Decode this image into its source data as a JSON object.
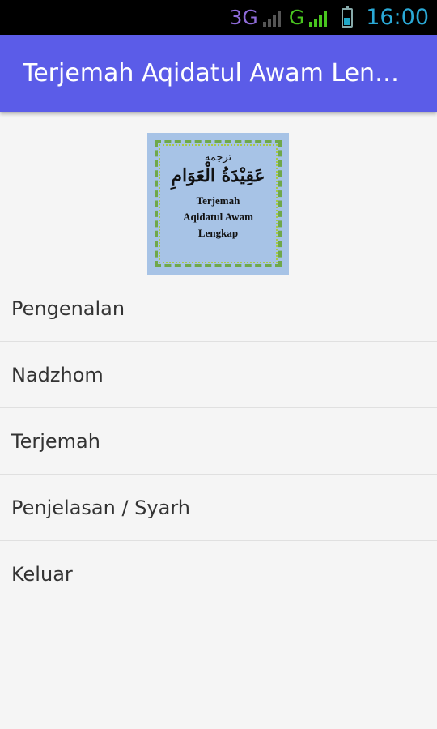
{
  "status_bar": {
    "network_1": "3G",
    "network_2": "G",
    "time": "16:00"
  },
  "app_bar": {
    "title": "Terjemah Aqidatul Awam Len…"
  },
  "logo": {
    "arabic_small": "ترجمه",
    "arabic_big": "عَقِيْدَةُ الْعَوَامِ",
    "latin_lines": [
      "Terjemah",
      "Aqidatul Awam",
      "Lengkap"
    ]
  },
  "menu": {
    "items": [
      {
        "label": "Pengenalan"
      },
      {
        "label": "Nadzhom"
      },
      {
        "label": "Terjemah"
      },
      {
        "label": "Penjelasan / Syarh"
      },
      {
        "label": "Keluar"
      }
    ]
  }
}
